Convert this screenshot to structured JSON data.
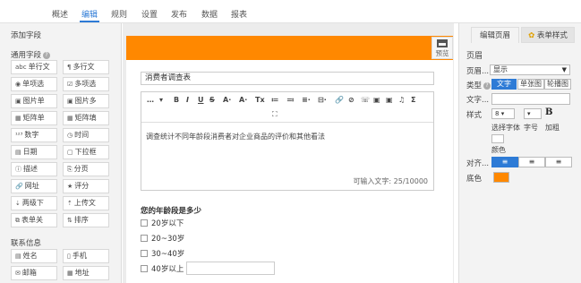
{
  "topnav": {
    "tabs": [
      "概述",
      "编辑",
      "规则",
      "设置",
      "发布",
      "数据",
      "报表"
    ],
    "active": "编辑"
  },
  "left": {
    "add_field": "添加字段",
    "common_fields": "通用字段",
    "fields": [
      {
        "icon": "abc",
        "label": "单行文"
      },
      {
        "icon": "¶",
        "label": "多行文"
      },
      {
        "icon": "◉",
        "label": "单项选"
      },
      {
        "icon": "☑",
        "label": "多项选"
      },
      {
        "icon": "▣",
        "label": "图片单"
      },
      {
        "icon": "▣",
        "label": "图片多"
      },
      {
        "icon": "▦",
        "label": "矩阵单"
      },
      {
        "icon": "▦",
        "label": "矩阵填"
      },
      {
        "icon": "¹²³",
        "label": "数字"
      },
      {
        "icon": "◷",
        "label": "时间"
      },
      {
        "icon": "▤",
        "label": "日期"
      },
      {
        "icon": "▢",
        "label": "下拉框"
      },
      {
        "icon": "ⓘ",
        "label": "描述"
      },
      {
        "icon": "⎘",
        "label": "分页"
      },
      {
        "icon": "🔗",
        "label": "网址"
      },
      {
        "icon": "★",
        "label": "评分"
      },
      {
        "icon": "⇣",
        "label": "两级下"
      },
      {
        "icon": "⇡",
        "label": "上传文"
      },
      {
        "icon": "⧉",
        "label": "表单关"
      },
      {
        "icon": "⇅",
        "label": "排序"
      }
    ],
    "contact_info": "联系信息",
    "contact_fields": [
      {
        "icon": "▤",
        "label": "姓名"
      },
      {
        "icon": "▯",
        "label": "手机"
      },
      {
        "icon": "✉",
        "label": "邮箱"
      },
      {
        "icon": "▦",
        "label": "地址"
      }
    ]
  },
  "canvas": {
    "preview_label": "预览",
    "form_title": "消费者调查表",
    "toolbar_row1": [
      "…",
      "▾",
      "B",
      "I",
      "U",
      "S",
      "A·",
      "A·",
      "Tx",
      "≔",
      "≕",
      "≡·",
      "⊟·",
      "🔗",
      "⊘",
      "☏",
      "▣",
      "▣",
      "♫",
      "Σ"
    ],
    "toolbar_row2": [
      "⛶"
    ],
    "description": "调查统计不同年龄段消费者对企业商品的评价和其他看法",
    "counter": "可输入文字: 25/10000",
    "question": "您的年龄段是多少",
    "options": [
      "20岁以下",
      "20~30岁",
      "30~40岁",
      "40岁以上"
    ]
  },
  "right": {
    "tab_edit": "编辑页眉",
    "tab_style": "表单样式",
    "header_label": "页眉",
    "header_field_label": "页眉...",
    "header_select": "显示",
    "type_label": "类型",
    "type_options": [
      "文字",
      "单张图",
      "轮播图"
    ],
    "text_label": "文字...",
    "style_label": "样式",
    "font_select": "8",
    "size_select": "",
    "bold": "B",
    "font_label": "选择字体",
    "size_label": "字号",
    "bold_label": "加粗",
    "color_label": "颜色",
    "align_label": "对齐...",
    "align_options": [
      "≡",
      "≡",
      "≡"
    ],
    "bg_label": "底色",
    "accent_color": "#ff8800",
    "primary_color": "#2e7bd6"
  }
}
